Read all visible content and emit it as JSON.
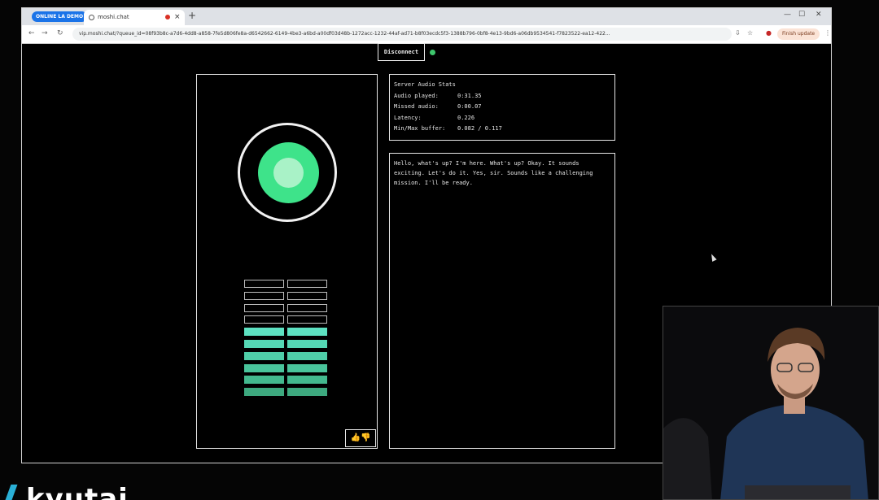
{
  "browser": {
    "profile_badge": "ONLINE LA DEMO",
    "tab_title": "moshi.chat",
    "new_tab_symbol": "+",
    "url": "vip.moshi.chat/?queue_id=08f93b8c-a7d6-4dd8-a858-7fe5d806fe8a-d6542662-6149-4be3-a6bd-a00df03d48b-1272acc-1232-44af-ad71-b8f03ecdc5f3-1388b796-0bf8-4e13-9bd6-a06db9534541-f7823522-ea12-422...",
    "finish_update_label": "Finish update"
  },
  "app": {
    "disconnect_label": "Disconnect",
    "status_color": "#3ec66d",
    "orb_colors": {
      "ring": "#f2f2f2",
      "core": "#3ee38a",
      "center": "#a9f2c7"
    },
    "meter": {
      "total_rows": 10,
      "active_rows": 6,
      "row_colors": [
        "#5de2c2",
        "#55d8b5",
        "#4fcea8",
        "#49c49b",
        "#43b98e",
        "#3da97f"
      ]
    },
    "feedback": {
      "thumbs_up": "👍",
      "thumbs_down": "👎"
    }
  },
  "stats": {
    "title": "Server Audio Stats",
    "rows": [
      {
        "label": "Audio played:",
        "value": "0:31.35"
      },
      {
        "label": "Missed audio:",
        "value": "0:00.07"
      },
      {
        "label": "Latency:",
        "value": "0.226"
      },
      {
        "label": "Min/Max buffer:",
        "value": "0.082 / 0.117"
      }
    ]
  },
  "transcript": {
    "text": "Hello, what's up? I'm here. What's up? Okay. It sounds exciting. Let's do it. Yes, sir. Sounds like a challenging mission. I'll be ready."
  },
  "brand": {
    "name": "kyutai"
  }
}
